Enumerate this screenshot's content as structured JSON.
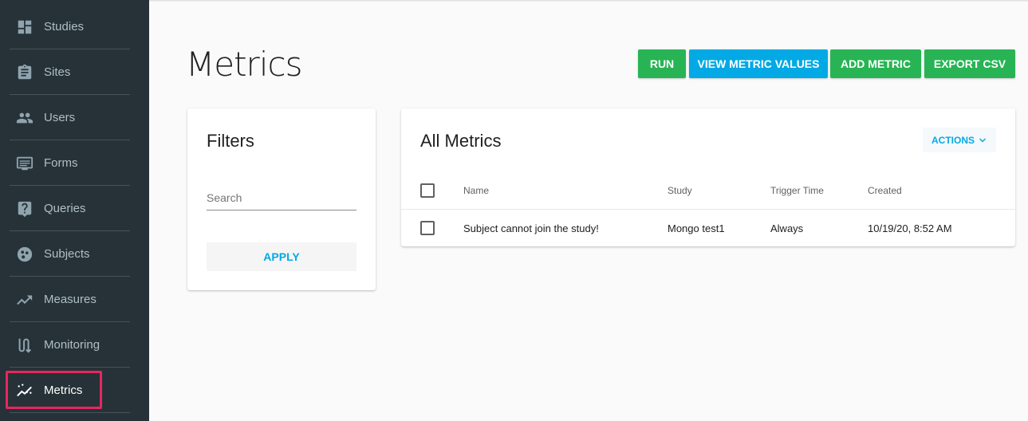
{
  "sidebar": {
    "items": [
      {
        "label": "Studies",
        "icon": "dashboard-icon"
      },
      {
        "label": "Sites",
        "icon": "clipboard-icon"
      },
      {
        "label": "Users",
        "icon": "people-icon"
      },
      {
        "label": "Forms",
        "icon": "form-icon"
      },
      {
        "label": "Queries",
        "icon": "help-icon"
      },
      {
        "label": "Subjects",
        "icon": "subjects-icon"
      },
      {
        "label": "Measures",
        "icon": "trending-icon"
      },
      {
        "label": "Monitoring",
        "icon": "monitoring-icon"
      },
      {
        "label": "Metrics",
        "icon": "metrics-icon",
        "active": true
      }
    ]
  },
  "page": {
    "title": "Metrics"
  },
  "toolbar": {
    "run_label": "RUN",
    "view_label": "VIEW METRIC VALUES",
    "add_label": "ADD METRIC",
    "export_label": "EXPORT CSV"
  },
  "filters": {
    "title": "Filters",
    "search_placeholder": "Search",
    "apply_label": "APPLY"
  },
  "metrics": {
    "title": "All Metrics",
    "actions_label": "ACTIONS",
    "columns": [
      "Name",
      "Study",
      "Trigger Time",
      "Created"
    ],
    "rows": [
      {
        "name": "Subject cannot join the study!",
        "study": "Mongo test1",
        "trigger": "Always",
        "created": "10/19/20, 8:52 AM"
      }
    ]
  },
  "colors": {
    "sidebar": "#263238",
    "green": "#28b455",
    "blue": "#03a9e4",
    "highlight": "#e8265e"
  }
}
